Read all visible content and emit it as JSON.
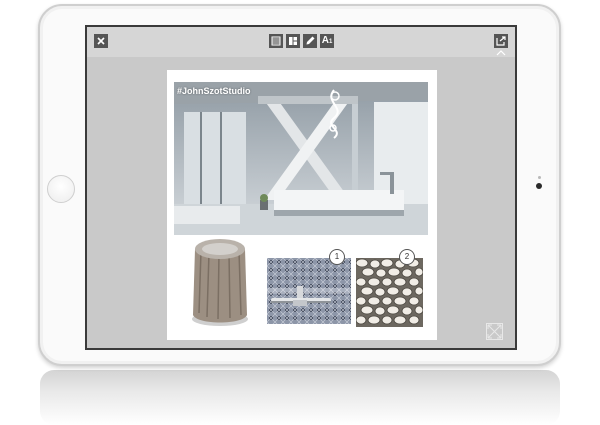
{
  "window": {
    "device": "tablet",
    "screen_background": "#c9c9c9",
    "toolbar_background": "#d6d6d6"
  },
  "toolbar": {
    "left_icon": "close-icon",
    "center_icons": [
      "grid-layout-icon",
      "columns-layout-icon",
      "pencil-icon",
      "text-size-icon"
    ],
    "right_icon": "export-icon",
    "text_tool_label": "A",
    "text_tool_sub": "1"
  },
  "board": {
    "photo_hashtag": "#JohnSzotStudio",
    "items": [
      {
        "name": "wood-stump-stool",
        "badge": ""
      },
      {
        "name": "faucet-on-tile",
        "badge": "1"
      },
      {
        "name": "pebble-stones",
        "badge": "2"
      }
    ]
  },
  "colors": {
    "toolbar_icon": "#555555",
    "frame": "#3a3a3a"
  }
}
